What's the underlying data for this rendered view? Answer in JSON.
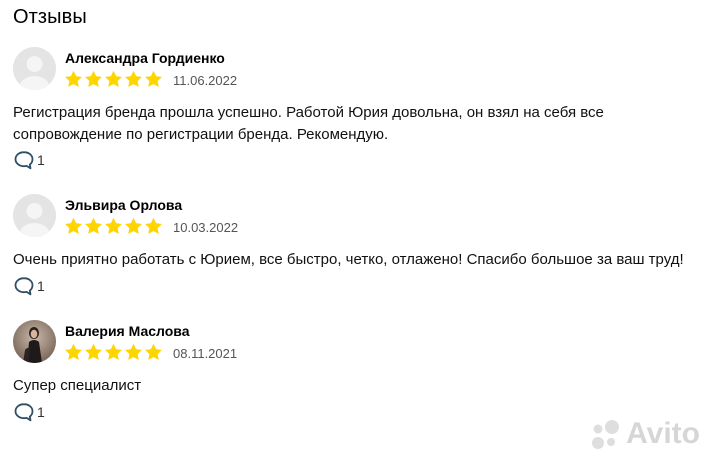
{
  "section": {
    "title": "Отзывы"
  },
  "reviews": [
    {
      "author": "Александра Гордиенко",
      "rating": 5,
      "date": "11.06.2022",
      "text": "Регистрация бренда прошла успешно. Работой Юрия довольна, он взял на себя все сопровождение по регистрации бренда. Рекомендую.",
      "comments": "1",
      "avatar": "placeholder"
    },
    {
      "author": "Эльвира Орлова",
      "rating": 5,
      "date": "10.03.2022",
      "text": "Очень приятно работать с Юрием, все быстро, четко, отлажено! Спасибо большое за ваш труд!",
      "comments": "1",
      "avatar": "placeholder"
    },
    {
      "author": "Валерия Маслова",
      "rating": 5,
      "date": "08.11.2021",
      "text": "Супер специалист",
      "comments": "1",
      "avatar": "photo"
    }
  ],
  "watermark": {
    "brand": "Avito"
  },
  "colors": {
    "star": "#FFD500",
    "text": "#111111",
    "muted": "#555555",
    "avatar": "#e6e6e6"
  },
  "icons": {
    "comment": "comment-bubble-icon",
    "star": "star-icon",
    "avatar": "user-avatar-icon"
  }
}
